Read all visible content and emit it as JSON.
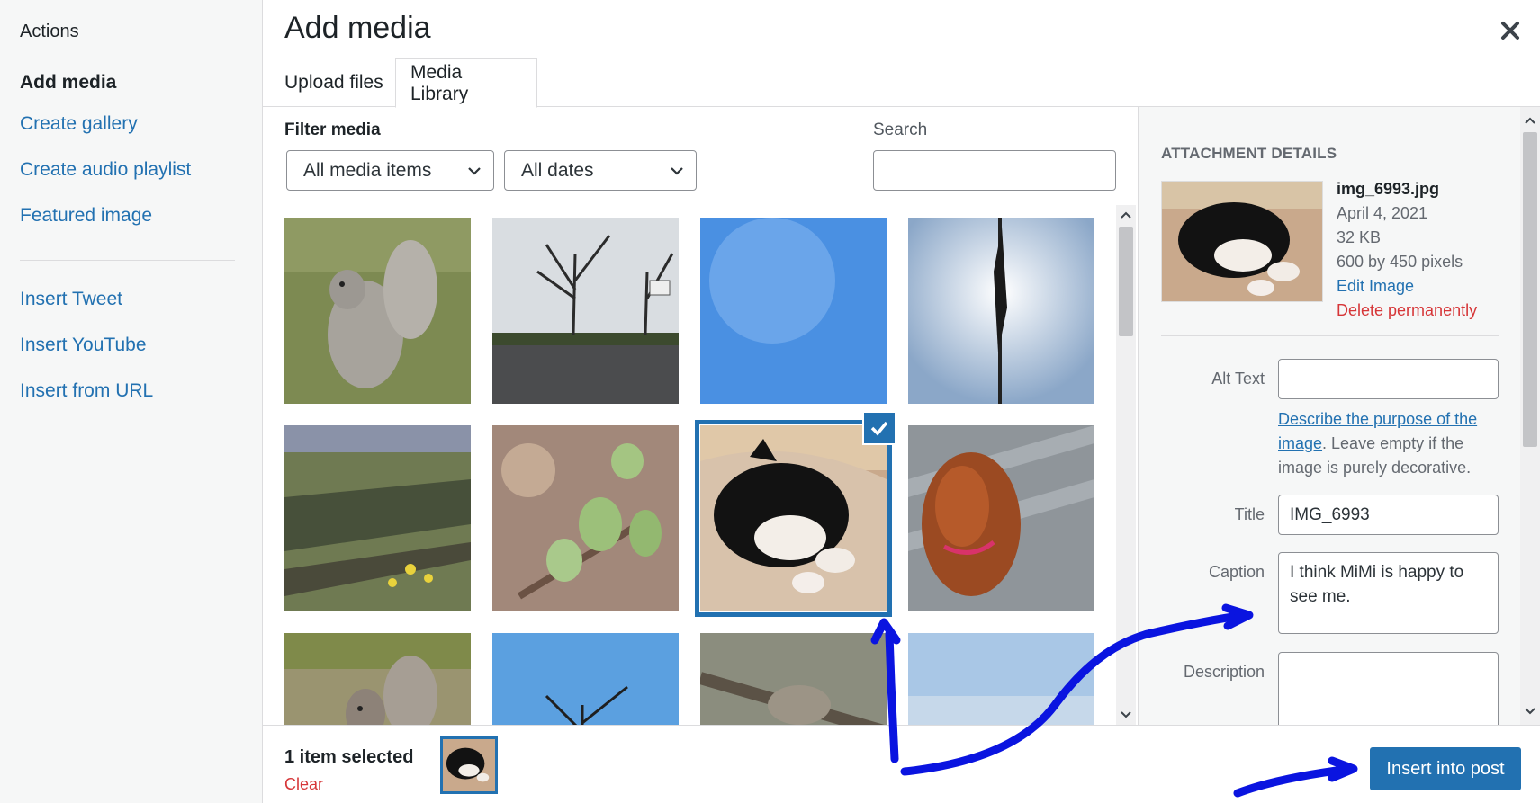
{
  "menu": {
    "title": "Actions",
    "items": [
      {
        "label": "Add media"
      },
      {
        "label": "Create gallery"
      },
      {
        "label": "Create audio playlist"
      },
      {
        "label": "Featured image"
      },
      {
        "label": "Insert Tweet"
      },
      {
        "label": "Insert YouTube"
      },
      {
        "label": "Insert from URL"
      }
    ]
  },
  "header": {
    "title": "Add media",
    "close_icon": "close-icon",
    "tabs": [
      {
        "label": "Upload files"
      },
      {
        "label": "Media Library"
      }
    ]
  },
  "toolbar": {
    "filter_label": "Filter media",
    "type_select": "All media items",
    "date_select": "All dates",
    "search_label": "Search",
    "search_value": ""
  },
  "grid": {
    "items": [
      "squirrel",
      "bare-trees-basketball",
      "moon-sky",
      "flag-pole",
      "park-shadows",
      "green-buds",
      "cat-sleeping",
      "red-dog",
      "squirrel-2",
      "tree-sky",
      "squirrel-tree",
      "sky"
    ],
    "selected_item": "cat-sleeping"
  },
  "details": {
    "heading": "Attachment Details",
    "filename": "img_6993.jpg",
    "date": "April 4, 2021",
    "size": "32 KB",
    "dimensions": "600 by 450 pixels",
    "edit_link": "Edit Image",
    "delete_link": "Delete permanently",
    "alt_label": "Alt Text",
    "alt_value": "",
    "alt_help_link": "Describe the purpose of the image",
    "alt_help_text": ". Leave empty if the image is purely decorative.",
    "title_label": "Title",
    "title_value": "IMG_6993",
    "caption_label": "Caption",
    "caption_value": "I think MiMi is happy to see me.",
    "description_label": "Description",
    "description_value": ""
  },
  "bottom": {
    "selected_text": "1 item selected",
    "clear_label": "Clear",
    "insert_label": "Insert into post"
  },
  "colors": {
    "accent": "#2271b1",
    "danger": "#d63638",
    "annotation": "#0a14e0"
  }
}
